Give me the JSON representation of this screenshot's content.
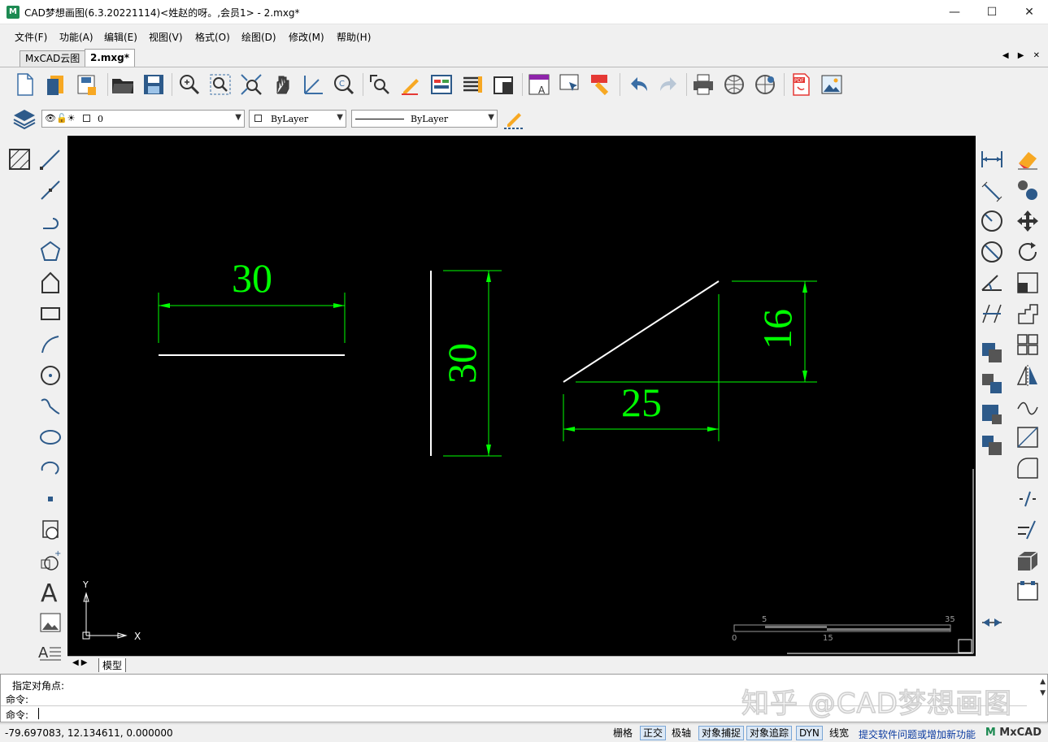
{
  "window": {
    "title": "CAD梦想画图(6.3.20221114)<姓赵的呀。,会员1> - 2.mxg*",
    "app_icon": "mxcad-logo-icon",
    "buttons": {
      "minimize": "—",
      "maximize": "☐",
      "close": "✕"
    }
  },
  "menu": {
    "items": [
      "文件(F)",
      "功能(A)",
      "编辑(E)",
      "视图(V)",
      "格式(O)",
      "绘图(D)",
      "修改(M)",
      "帮助(H)"
    ]
  },
  "tabs": {
    "items": [
      "MxCAD云图",
      "2.mxg*"
    ],
    "active": "2.mxg*",
    "nav": "◀ ▶ ✕"
  },
  "toolbar": {
    "icons": [
      "new-file-icon",
      "open-file-icon",
      "save-icon",
      "open-folder-icon",
      "save-as-icon",
      "zoom-realtime-icon",
      "zoom-window-icon",
      "zoom-extents-icon",
      "pan-hand-icon",
      "ucs-axis-icon",
      "zoom-previous-icon",
      "zoom-selection-icon",
      "pencil-edit-icon",
      "properties-icon",
      "layer-list-icon",
      "layer-state-icon",
      "text-style-icon",
      "select-icon",
      "match-properties-icon",
      "undo-icon",
      "redo-icon",
      "print-icon",
      "web-icon",
      "web-share-icon",
      "pdf-icon",
      "image-icon"
    ]
  },
  "properties_bar": {
    "layer_value": "0",
    "color_value": "ByLayer",
    "linetype_value": "ByLayer"
  },
  "left_tools": [
    "hatch-icon",
    "line-icon",
    "ray-icon",
    "polyline-arc-icon",
    "polygon-icon",
    "region-icon",
    "rectangle-icon",
    "arc-icon",
    "circle-icon",
    "spline-icon",
    "ellipse-icon",
    "ellipse-arc-icon",
    "point-icon",
    "block-insert-icon",
    "block-define-icon",
    "multiline-text-icon",
    "image-insert-icon",
    "text-format-icon"
  ],
  "right_tools_a": [
    "dim-linear-icon",
    "dim-aligned-icon",
    "dim-radius-icon",
    "dim-diameter-icon",
    "dim-angular-icon",
    "dim-continue-icon",
    "copy-layer-icon",
    "offset-icon",
    "array-icon",
    "move-stack-icon"
  ],
  "right_tools_b": [
    "erase-icon",
    "copy-icon",
    "move-icon",
    "rotate-icon",
    "scale-icon",
    "stretch-icon",
    "array-rect-icon",
    "mirror-icon",
    "spline-edit-icon",
    "trim-icon",
    "fillet-icon",
    "break-icon",
    "extend-icon",
    "3d-box-icon",
    "chamfer-icon",
    "join-icon"
  ],
  "drawing": {
    "dimensions": [
      "30",
      "30",
      "16",
      "25"
    ],
    "ucs": {
      "x_label": "X",
      "y_label": "Y"
    },
    "scale_bar": {
      "top_labels": [
        "5",
        "35"
      ],
      "bottom_labels": [
        "0",
        "15"
      ]
    },
    "colors": {
      "background": "#000000",
      "geometry": "#ffffff",
      "dimension": "#00ff00"
    }
  },
  "layout_tabs": {
    "model": "模型"
  },
  "command": {
    "lines": [
      "指定对角点:",
      "命令:",
      "命令:"
    ]
  },
  "status": {
    "coords": "-79.697083,  12.134611,  0.000000",
    "toggles": [
      {
        "label": "栅格",
        "on": false
      },
      {
        "label": "正交",
        "on": true
      },
      {
        "label": "极轴",
        "on": false
      },
      {
        "label": "对象捕捉",
        "on": true
      },
      {
        "label": "对象追踪",
        "on": true
      },
      {
        "label": "DYN",
        "on": true
      },
      {
        "label": "线宽",
        "on": false
      }
    ],
    "feedback": "提交软件问题或增加新功能",
    "brand": "MxCAD"
  },
  "watermark": "知乎 @CAD梦想画图"
}
